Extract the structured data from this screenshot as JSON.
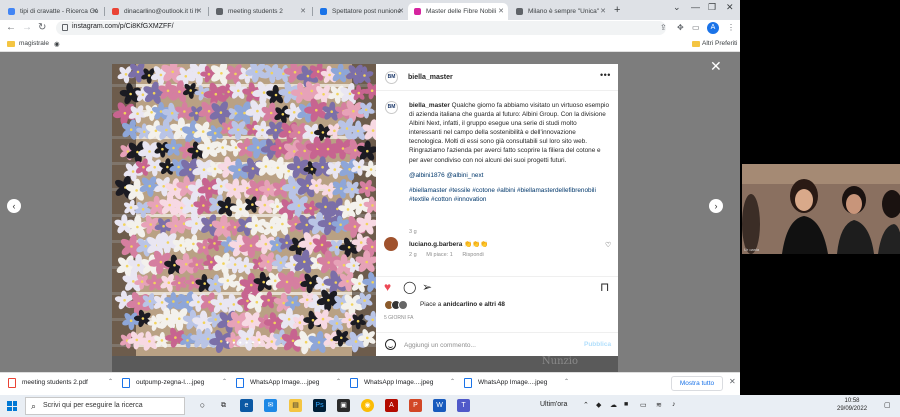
{
  "browser": {
    "tabs": [
      {
        "title": "tipi di cravatte - Ricerca Go",
        "color": "#4285f4"
      },
      {
        "title": "dinacarlino@outlook.it ti h",
        "color": "#ea4335"
      },
      {
        "title": "meeting students 2",
        "color": "#5f6368"
      },
      {
        "title": "Spettatore post nunione",
        "color": "#1a73e8"
      },
      {
        "title": "Master delle Fibre Nobili",
        "color": "#d6249f"
      },
      {
        "title": "Milano è sempre \"Unica\"",
        "color": "#5f6368"
      }
    ],
    "new_tab": "+",
    "url": "instagram.com/p/Ci8KfGXMZFF/",
    "profile_initial": "A",
    "bookmarks": {
      "left": "magistrale",
      "right": "Altri Preferiti"
    }
  },
  "post": {
    "username": "biella_master",
    "logo_text": "BM",
    "caption_user": "biella_master",
    "caption": "Qualche giorno fa abbiamo visitato un virtuoso esempio di azienda italiana che guarda al futuro: Albini Group. Con la divisione Albini Next, infatti, il gruppo esegue una serie di studi molto interessanti nel campo della sostenibilità e dell'innovazione tecnologica. Molti di essi sono già consultabili sul loro sito web. Ringraziamo l'azienda per averci fatto scoprire la filiera del cotone e per aver condiviso con noi alcuni dei suoi progetti futuri.",
    "mentions": "@albini1876 @albini_next",
    "hashtags": "#biellamaster #tessile #cotone #albini #biellamasterdellefibrenobili #textile #cotton #innovation",
    "caption_age": "3 g",
    "comment": {
      "user": "luciano.g.barbera",
      "text": "👏👏👏",
      "age": "2 g",
      "likes": "Mi piace: 1",
      "reply": "Rispondi"
    },
    "likes_text_prefix": "Piace a",
    "likes_user": "anidcarlino",
    "likes_rest": "e altri 48",
    "date": "5 GIORNI FA",
    "comment_placeholder": "Aggiungi un commento...",
    "publish": "Pubblica",
    "photo_dots": "● ● ● ● ● ●",
    "photo_overlay_text": "Nunzio"
  },
  "video": {
    "label": "Ur oania"
  },
  "downloads": {
    "items": [
      {
        "name": "meeting students 2.pdf",
        "color": "#ea4335"
      },
      {
        "name": "outpump-zegna-l....jpeg",
        "color": "#1a73e8"
      },
      {
        "name": "WhatsApp Image....jpeg",
        "color": "#1a73e8"
      },
      {
        "name": "WhatsApp Image....jpeg",
        "color": "#1a73e8"
      },
      {
        "name": "WhatsApp Image....jpeg",
        "color": "#1a73e8"
      }
    ],
    "show_all": "Mostra tutto"
  },
  "taskbar": {
    "search_placeholder": "Scrivi qui per eseguire la ricerca",
    "tray_news": "Ultim'ora",
    "time": "10:58",
    "date": "29/09/2022"
  },
  "colors": {
    "instagram_link": "#00376b",
    "heart_red": "#ed4956",
    "publish_blue": "#b2dffc"
  }
}
